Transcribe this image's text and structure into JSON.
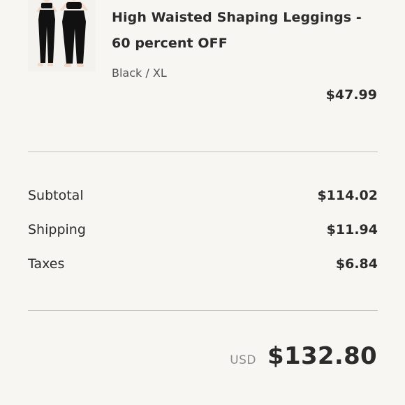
{
  "cart_item": {
    "image_icon": "product-photo-leggings",
    "title": "High Waisted Shaping Leggings - 60 percent OFF",
    "variant": "Black / XL",
    "price": "$47.99"
  },
  "summary": {
    "subtotal_label": "Subtotal",
    "subtotal_value": "$114.02",
    "shipping_label": "Shipping",
    "shipping_value": "$11.94",
    "taxes_label": "Taxes",
    "taxes_value": "$6.84"
  },
  "total": {
    "currency": "USD",
    "amount": "$132.80"
  }
}
